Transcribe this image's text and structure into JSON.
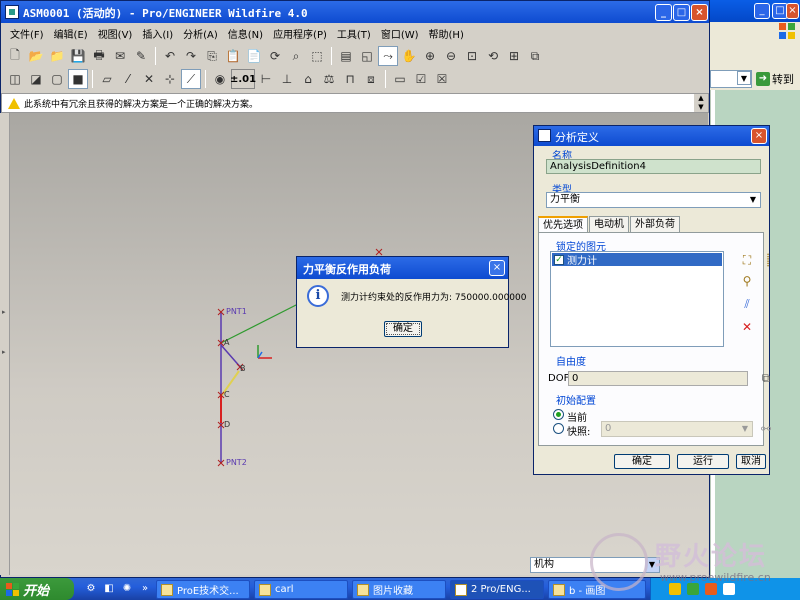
{
  "main_window": {
    "title": "ASM0001 (活动的) - Pro/ENGINEER Wildfire 4.0",
    "minimize": "_",
    "maximize": "□",
    "close": "×"
  },
  "menu": [
    {
      "label": "文件(F)"
    },
    {
      "label": "编辑(E)"
    },
    {
      "label": "视图(V)"
    },
    {
      "label": "插入(I)"
    },
    {
      "label": "分析(A)"
    },
    {
      "label": "信息(N)"
    },
    {
      "label": "应用程序(P)"
    },
    {
      "label": "工具(T)"
    },
    {
      "label": "窗口(W)"
    },
    {
      "label": "帮助(H)"
    }
  ],
  "toolbar": {
    "precision_indicator": "±.01"
  },
  "message_bar": {
    "text": "此系统中有冗余且获得的解决方案是一个正确的解决方案。"
  },
  "model": {
    "datum_labels": [
      "PNT1",
      "A",
      "B",
      "C",
      "D",
      "PNT2"
    ]
  },
  "bottom_filter": {
    "value": "机构"
  },
  "analysis_dialog": {
    "title": "分析定义",
    "name_label": "名称",
    "name_value": "AnalysisDefinition4",
    "type_label": "类型",
    "type_value": "力平衡",
    "tabs": [
      "优先选项",
      "电动机",
      "外部负荷"
    ],
    "locked_entities_label": "锁定的图元",
    "locked_items": [
      {
        "label": "测力计",
        "checked": true
      }
    ],
    "dof_group_label": "自由度",
    "dof_label": "DOF",
    "dof_value": "0",
    "initial_config_label": "初始配置",
    "radio_current": "当前",
    "radio_snapshot": "快照:",
    "snapshot_value": "0",
    "buttons": {
      "ok": "确定",
      "run": "运行",
      "cancel": "取消"
    }
  },
  "reaction_dialog": {
    "title": "力平衡反作用负荷",
    "message": "测力计约束处的反作用力为: 750000.000000",
    "ok": "确定"
  },
  "browser": {
    "go_label": "转到"
  },
  "taskbar": {
    "start": "开始",
    "tasks": [
      {
        "label": "ProE技术交..."
      },
      {
        "label": "carl"
      },
      {
        "label": "图片收藏"
      },
      {
        "label": "2 Pro/ENG..."
      },
      {
        "label": "b - 画图"
      }
    ]
  },
  "watermark": {
    "text": "野火论坛",
    "url": "www.proewildfire.cn"
  },
  "colors": {
    "xp_title_blue": "#0e4bd0",
    "selection_blue": "#316ac5",
    "link_green": "#2f9a2f",
    "axis_red": "#d82020",
    "datum_purple": "#5a3ab0"
  }
}
